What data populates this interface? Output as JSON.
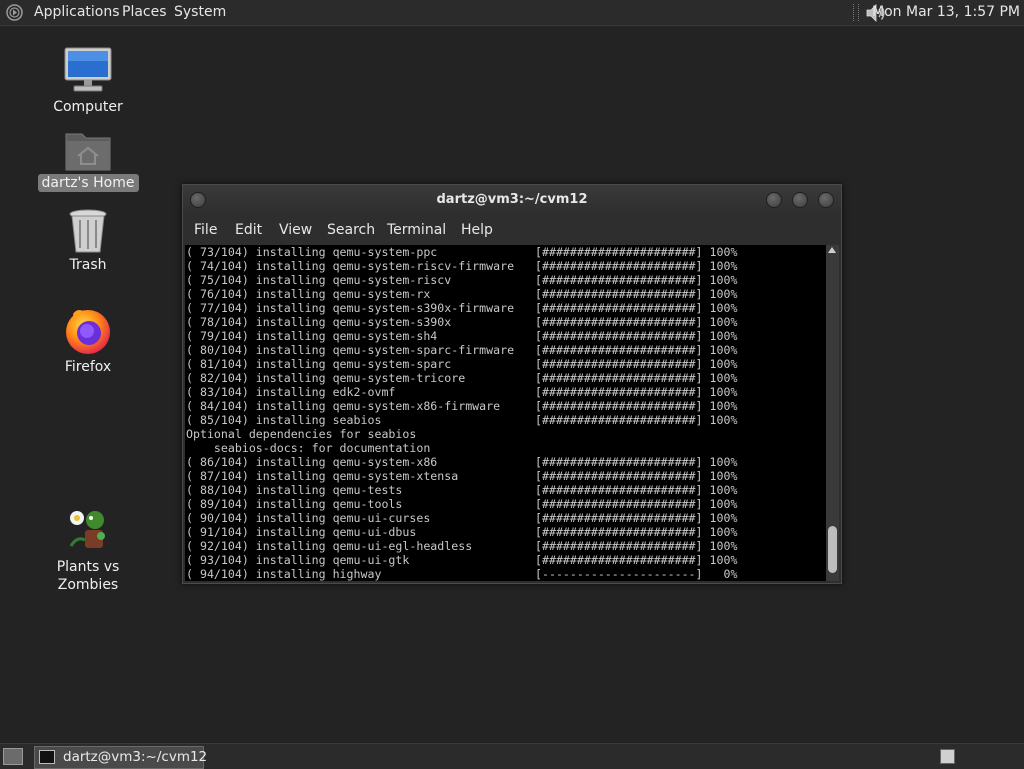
{
  "top_panel": {
    "menus": [
      "Applications",
      "Places",
      "System"
    ],
    "clock": "Mon Mar 13,  1:57 PM"
  },
  "desktop": {
    "icons": [
      {
        "label": "Computer",
        "icon": "computer-icon"
      },
      {
        "label": "dartz's Home",
        "icon": "home-folder-icon",
        "selected": true
      },
      {
        "label": "Trash",
        "icon": "trash-icon"
      },
      {
        "label": "Firefox",
        "icon": "firefox-icon"
      },
      {
        "label": "Plants vs Zombies",
        "icon": "plants-vs-zombies-icon"
      }
    ]
  },
  "terminal": {
    "title": "dartz@vm3:~/cvm12",
    "menu": [
      "File",
      "Edit",
      "View",
      "Search",
      "Terminal",
      "Help"
    ],
    "lines": [
      "( 73/104) installing qemu-system-ppc              [######################] 100%",
      "( 74/104) installing qemu-system-riscv-firmware   [######################] 100%",
      "( 75/104) installing qemu-system-riscv            [######################] 100%",
      "( 76/104) installing qemu-system-rx               [######################] 100%",
      "( 77/104) installing qemu-system-s390x-firmware   [######################] 100%",
      "( 78/104) installing qemu-system-s390x            [######################] 100%",
      "( 79/104) installing qemu-system-sh4              [######################] 100%",
      "( 80/104) installing qemu-system-sparc-firmware   [######################] 100%",
      "( 81/104) installing qemu-system-sparc            [######################] 100%",
      "( 82/104) installing qemu-system-tricore          [######################] 100%",
      "( 83/104) installing edk2-ovmf                    [######################] 100%",
      "( 84/104) installing qemu-system-x86-firmware     [######################] 100%",
      "( 85/104) installing seabios                      [######################] 100%",
      "Optional dependencies for seabios",
      "    seabios-docs: for documentation",
      "( 86/104) installing qemu-system-x86              [######################] 100%",
      "( 87/104) installing qemu-system-xtensa           [######################] 100%",
      "( 88/104) installing qemu-tests                   [######################] 100%",
      "( 89/104) installing qemu-tools                   [######################] 100%",
      "( 90/104) installing qemu-ui-curses               [######################] 100%",
      "( 91/104) installing qemu-ui-dbus                 [######################] 100%",
      "( 92/104) installing qemu-ui-egl-headless         [######################] 100%",
      "( 93/104) installing qemu-ui-gtk                  [######################] 100%",
      "( 94/104) installing highway                      [----------------------]   0%"
    ]
  },
  "taskbar": {
    "task_label": "dartz@vm3:~/cvm12"
  }
}
